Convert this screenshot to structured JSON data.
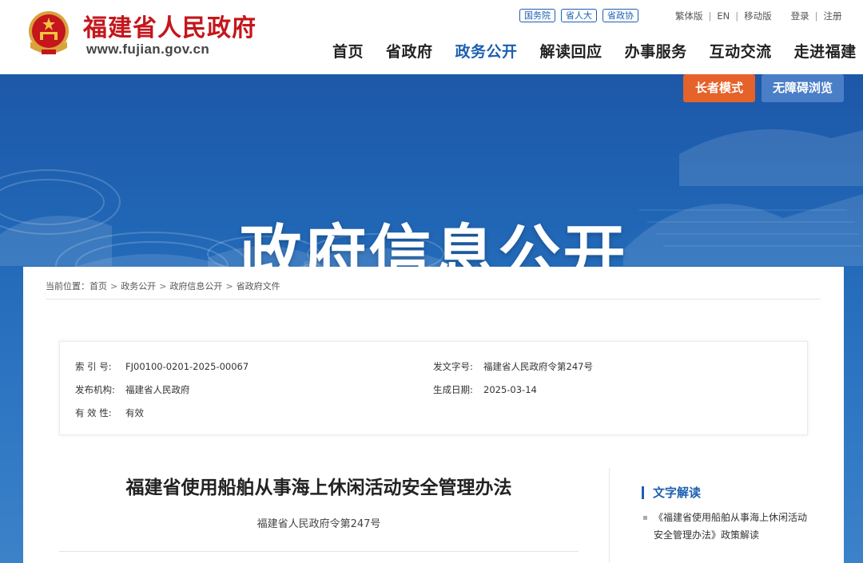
{
  "header": {
    "site_name": "福建省人民政府",
    "site_url": "www.fujian.gov.cn",
    "quick_links": [
      "国务院",
      "省人大",
      "省政协"
    ],
    "util": {
      "traditional": "繁体版",
      "english": "EN",
      "mobile": "移动版",
      "login": "登录",
      "register": "注册"
    },
    "nav": [
      "首页",
      "省政府",
      "政务公开",
      "解读回应",
      "办事服务",
      "互动交流",
      "走进福建"
    ],
    "active_nav": "政务公开"
  },
  "banner": {
    "elder_mode": "长者模式",
    "accessible": "无障碍浏览",
    "title": "政府信息公开"
  },
  "breadcrumb": {
    "prefix": "当前位置：",
    "items": [
      "首页",
      "政务公开",
      "政府信息公开",
      "省政府文件"
    ],
    "separator": ">"
  },
  "info": {
    "index_label": "索 引 号:",
    "index_value": "FJ00100-0201-2025-00067",
    "doc_no_label": "发文字号:",
    "doc_no_value": "福建省人民政府令第247号",
    "issuer_label": "发布机构:",
    "issuer_value": "福建省人民政府",
    "date_label": "生成日期:",
    "date_value": "2025-03-14",
    "validity_label": "有 效 性:",
    "validity_value": "有效"
  },
  "document": {
    "title": "福建省使用船舶从事海上休闲活动安全管理办法",
    "subtitle": "福建省人民政府令第247号"
  },
  "sidebar": {
    "heading": "文字解读",
    "link": "《福建省使用船舶从事海上休闲活动安全管理办法》政策解读"
  },
  "colors": {
    "brand_red": "#c4161c",
    "brand_blue": "#1d5fb0",
    "elder_orange": "#e5622a"
  }
}
